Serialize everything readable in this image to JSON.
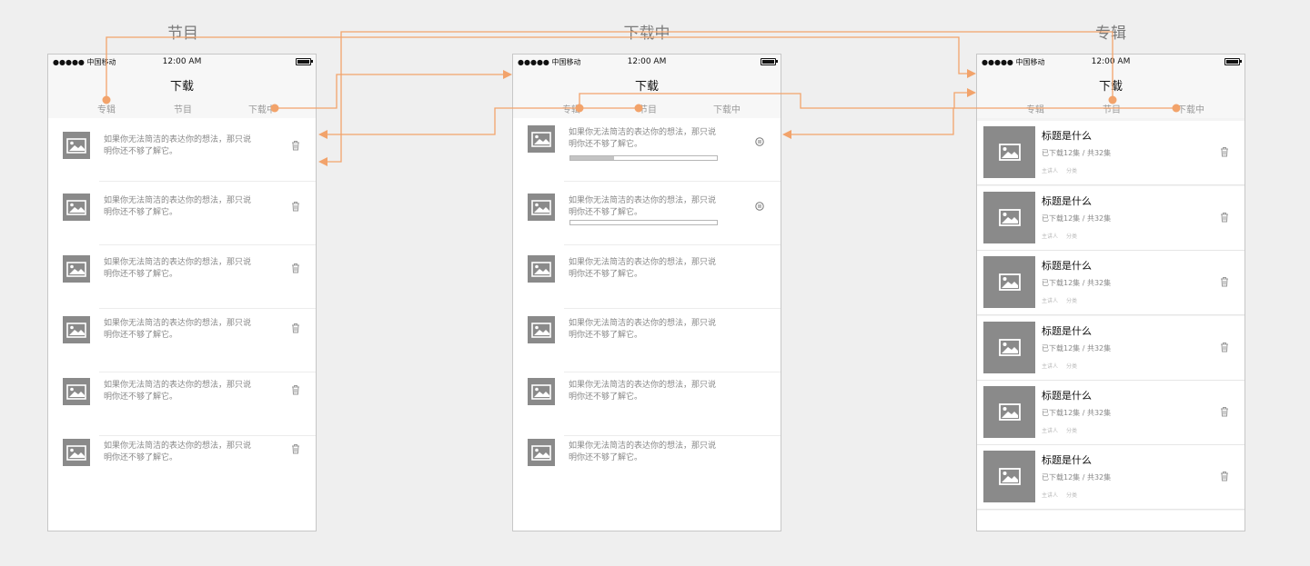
{
  "screen_titles": [
    "节目",
    "下载中",
    "专辑"
  ],
  "status_bar": {
    "signal": "●●●●● 中国移动",
    "time": "12:00 AM"
  },
  "nav_title": "下载",
  "tabs": [
    "专辑",
    "节目",
    "下载中"
  ],
  "item_text": "如果你无法简洁的表达你的想法，那只说明你还不够了解它。",
  "downloading_progress": [
    0.3,
    0.0
  ],
  "album": {
    "title": "标题是什么",
    "count": "已下载12集 / 共32集",
    "meta": [
      "主讲人",
      "分类"
    ]
  },
  "colors": {
    "accent": "#f2a36b",
    "thumb": "#8a8a8a",
    "background": "#efefef"
  }
}
